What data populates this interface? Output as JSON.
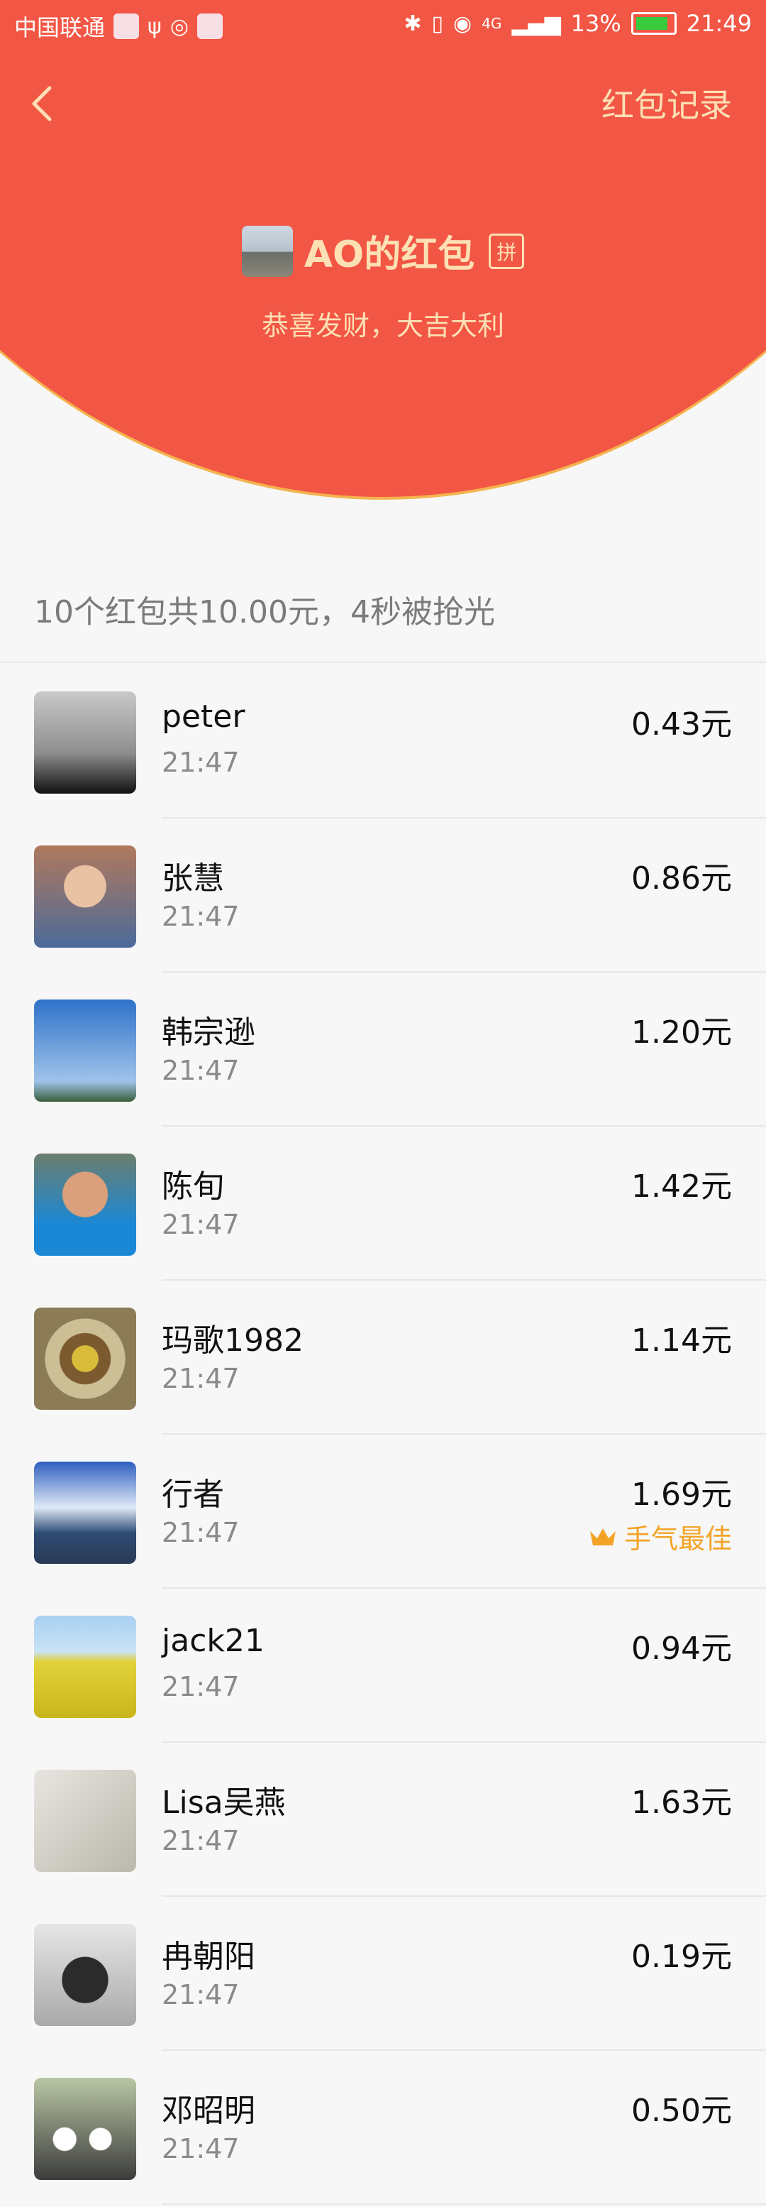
{
  "status_bar": {
    "carrier": "中国联通",
    "network": "4G",
    "battery": "13%",
    "time": "21:49"
  },
  "nav": {
    "back_icon": "chevron-left-icon",
    "right_label": "红包记录"
  },
  "header": {
    "title": "AO的红包",
    "pin_badge": "拼",
    "blessing": "恭喜发财，大吉大利",
    "bg_color": "#f25644",
    "accent_color": "#fde0b4"
  },
  "summary": "10个红包共10.00元，4秒被抢光",
  "records": [
    {
      "name": "peter",
      "time": "21:47",
      "amount": "0.43元"
    },
    {
      "name": "张慧",
      "time": "21:47",
      "amount": "0.86元"
    },
    {
      "name": "韩宗逊",
      "time": "21:47",
      "amount": "1.20元"
    },
    {
      "name": "陈旬",
      "time": "21:47",
      "amount": "1.42元"
    },
    {
      "name": "玛歌1982",
      "time": "21:47",
      "amount": "1.14元"
    },
    {
      "name": "行者",
      "time": "21:47",
      "amount": "1.69元",
      "best_label": "手气最佳",
      "best_icon": "crown-icon"
    },
    {
      "name": "jack21",
      "time": "21:47",
      "amount": "0.94元"
    },
    {
      "name": "Lisa吴燕",
      "time": "21:47",
      "amount": "1.63元"
    },
    {
      "name": "冉朝阳",
      "time": "21:47",
      "amount": "0.19元"
    },
    {
      "name": "邓昭明",
      "time": "21:47",
      "amount": "0.50元"
    }
  ],
  "best_color": "#f3a326"
}
